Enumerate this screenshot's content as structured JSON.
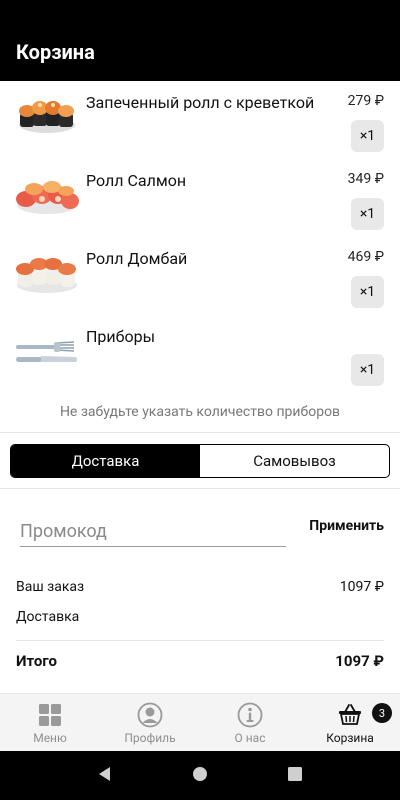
{
  "appbar": {
    "title": "Корзина"
  },
  "cart": {
    "items": [
      {
        "name": "Запеченный ролл с креветкой",
        "price": "279 ₽",
        "qty": "×1",
        "thumb": "baked-roll-image"
      },
      {
        "name": "Ролл Салмон",
        "price": "349 ₽",
        "qty": "×1",
        "thumb": "salmon-roll-image"
      },
      {
        "name": "Ролл Домбай",
        "price": "469 ₽",
        "qty": "×1",
        "thumb": "dombai-roll-image"
      },
      {
        "name": "Приборы",
        "price": "",
        "qty": "×1",
        "thumb": "cutlery-image"
      }
    ],
    "hint": "Не забудьте указать количество приборов"
  },
  "delivery_toggle": {
    "options": [
      "Доставка",
      "Самовывоз"
    ],
    "selected": "Доставка"
  },
  "promo": {
    "placeholder": "Промокод",
    "apply_label": "Применить"
  },
  "summary": {
    "order_label": "Ваш заказ",
    "order_value": "1097 ₽",
    "delivery_label": "Доставка",
    "delivery_value": "",
    "total_label": "Итого",
    "total_value": "1097 ₽"
  },
  "bottom_nav": {
    "items": [
      {
        "label": "Меню",
        "icon": "grid-icon"
      },
      {
        "label": "Профиль",
        "icon": "profile-icon"
      },
      {
        "label": "О нас",
        "icon": "info-icon"
      },
      {
        "label": "Корзина",
        "icon": "basket-icon"
      }
    ],
    "active": "Корзина",
    "cart_badge": "3"
  },
  "colors": {
    "primary": "#000000",
    "muted": "#8f8f8f",
    "qty_bg": "#e8e8e8"
  }
}
